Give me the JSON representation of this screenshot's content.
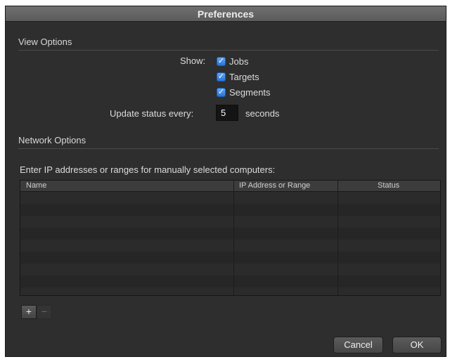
{
  "window": {
    "title": "Preferences"
  },
  "view_options": {
    "title": "View Options",
    "show_label": "Show:",
    "checkboxes": [
      {
        "label": "Jobs",
        "checked": true
      },
      {
        "label": "Targets",
        "checked": true
      },
      {
        "label": "Segments",
        "checked": true
      }
    ],
    "update_label": "Update status every:",
    "update_value": "5",
    "update_unit": "seconds"
  },
  "network_options": {
    "title": "Network Options",
    "instruction": "Enter IP addresses or ranges for manually selected computers:",
    "table": {
      "columns": [
        "Name",
        "IP Address or Range",
        "Status"
      ],
      "rows": []
    },
    "add_label": "+",
    "remove_label": "−"
  },
  "buttons": {
    "cancel": "Cancel",
    "ok": "OK"
  },
  "colors": {
    "window_bg": "#2e2e2e",
    "checkbox_accent": "#2b74d8"
  }
}
